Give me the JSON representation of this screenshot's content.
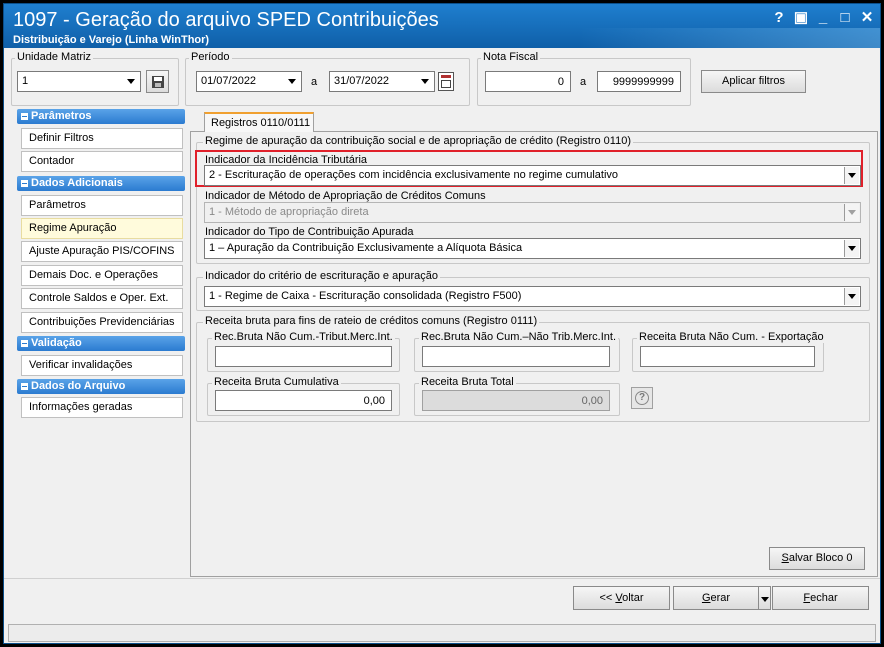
{
  "window": {
    "title": "1097 - Geração do arquivo SPED Contribuições",
    "subtitle": "Distribuição e Varejo (Linha WinThor)",
    "controls": {
      "help": "?",
      "restore": "▣",
      "minimize": "_",
      "maximize": "□",
      "close": "✕"
    }
  },
  "filters": {
    "unidade_label": "Unidade Matriz",
    "unidade_value": "1",
    "periodo_label": "Período",
    "periodo_start": "01/07/2022",
    "periodo_sep": "a",
    "periodo_end": "31/07/2022",
    "nota_label": "Nota Fiscal",
    "nota_start": "0",
    "nota_sep": "a",
    "nota_end": "9999999999",
    "apply_label": "Aplicar filtros"
  },
  "sidebar": {
    "parametros_head": "Parâmetros",
    "definir_filtros": "Definir Filtros",
    "contador": "Contador",
    "dados_head": "Dados Adicionais",
    "parametros_item": "Parâmetros",
    "regime": "Regime Apuração",
    "ajuste": "Ajuste Apuração PIS/COFINS",
    "demais": "Demais Doc. e Operações",
    "controle": "Controle Saldos e Oper. Ext.",
    "contribuicoes": "Contribuições Previdenciárias",
    "validacao_head": "Validação",
    "verificar": "Verificar invalidações",
    "arquivo_head": "Dados do Arquivo",
    "informacoes": "Informações geradas"
  },
  "main": {
    "tab": "Registros 0110/0111",
    "group1_title": "Regime de apuração da contribuição social e de apropriação de crédito (Registro 0110)",
    "incidencia_label": "Indicador da Incidência Tributária",
    "incidencia_value": "2 - Escrituração de operações com incidência exclusivamente no regime cumulativo",
    "metodo_label": "Indicador de Método de Apropriação de Créditos Comuns",
    "metodo_value": "1 - Método de apropriação direta",
    "tipo_label": "Indicador do Tipo de Contribuição Apurada",
    "tipo_value": "1 – Apuração da Contribuição Exclusivamente a Alíquota Básica",
    "group2_title": "Indicador do critério de escrituração e apuração",
    "criterio_value": "1 - Regime de Caixa - Escrituração consolidada (Registro F500)",
    "group3_title": "Receita bruta para fins de rateio de créditos comuns (Registro 0111)",
    "rec_trib_label": "Rec.Bruta Não Cum.-Tribut.Merc.Int.",
    "rec_trib_value": "",
    "rec_nao_trib_label": "Rec.Bruta Não Cum.–Não Trib.Merc.Int.",
    "rec_nao_trib_value": "",
    "rec_export_label": "Receita Bruta Não Cum. - Exportação",
    "rec_export_value": "",
    "rec_cum_label": "Receita Bruta Cumulativa",
    "rec_cum_value": "0,00",
    "rec_total_label": "Receita Bruta Total",
    "rec_total_value": "0,00",
    "help_icon": "?",
    "salvar_label": "Salvar Bloco 0"
  },
  "footer": {
    "voltar": "<< Voltar",
    "gerar": "Gerar",
    "fechar": "Fechar"
  },
  "colors": {
    "highlight": "#e0202a",
    "accent": "#1f7fcf"
  }
}
